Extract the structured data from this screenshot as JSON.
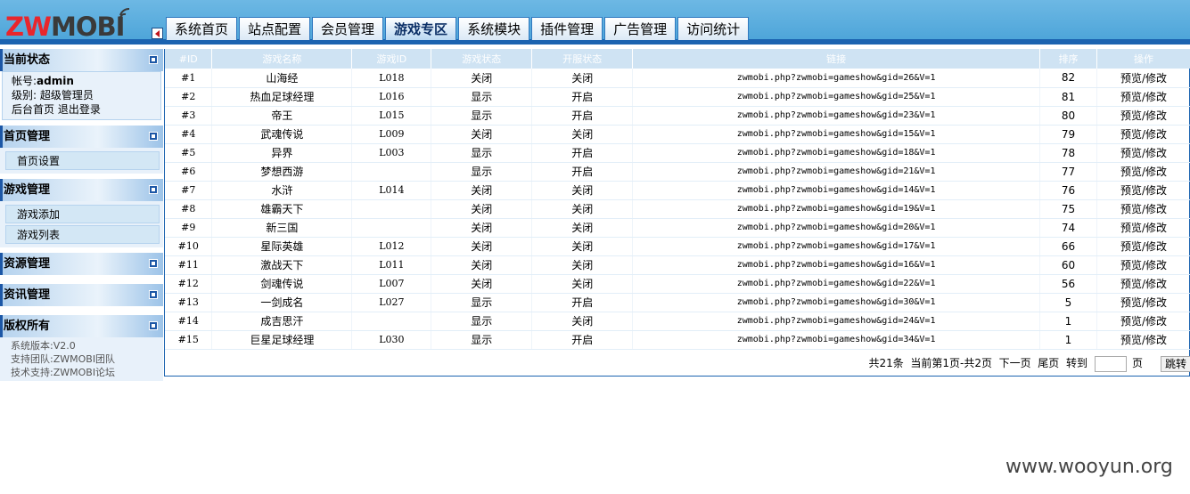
{
  "logo": {
    "red": "ZW",
    "gray": "MOBI"
  },
  "nav": {
    "tabs": [
      "系统首页",
      "站点配置",
      "会员管理",
      "游戏专区",
      "系统模块",
      "插件管理",
      "广告管理",
      "访问统计"
    ],
    "active_index": 3
  },
  "sidebar": {
    "status": {
      "title": "当前状态",
      "account_label": "帐号:",
      "account_value": "admin",
      "level_label": "级别:",
      "level_value": "超级管理员",
      "home_link": "后台首页",
      "logout_link": "退出登录"
    },
    "home_mgmt": {
      "title": "首页管理",
      "items": [
        "首页设置"
      ]
    },
    "game_mgmt": {
      "title": "游戏管理",
      "items": [
        "游戏添加",
        "游戏列表"
      ]
    },
    "resource_mgmt": {
      "title": "资源管理"
    },
    "news_mgmt": {
      "title": "资讯管理"
    },
    "copyright": {
      "title": "版权所有",
      "lines": [
        "系统版本:V2.0",
        "支持团队:ZWMOBI团队",
        "技术支持:ZWMOBI论坛"
      ]
    }
  },
  "table": {
    "headers": [
      "#ID",
      "游戏名称",
      "游戏ID",
      "游戏状态",
      "开服状态",
      "链接",
      "排序",
      "操作"
    ],
    "rows": [
      {
        "id": "#1",
        "name": "山海经",
        "gid": "L018",
        "status": "关闭",
        "server": "关闭",
        "link": "zwmobi.php?zwmobi=gameshow&gid=26&V=1",
        "sort": "82",
        "op": "预览/修改"
      },
      {
        "id": "#2",
        "name": "热血足球经理",
        "gid": "L016",
        "status": "显示",
        "server": "开启",
        "link": "zwmobi.php?zwmobi=gameshow&gid=25&V=1",
        "sort": "81",
        "op": "预览/修改"
      },
      {
        "id": "#3",
        "name": "帝王",
        "gid": "L015",
        "status": "显示",
        "server": "开启",
        "link": "zwmobi.php?zwmobi=gameshow&gid=23&V=1",
        "sort": "80",
        "op": "预览/修改"
      },
      {
        "id": "#4",
        "name": "武魂传说",
        "gid": "L009",
        "status": "关闭",
        "server": "关闭",
        "link": "zwmobi.php?zwmobi=gameshow&gid=15&V=1",
        "sort": "79",
        "op": "预览/修改"
      },
      {
        "id": "#5",
        "name": "异界",
        "gid": "L003",
        "status": "显示",
        "server": "开启",
        "link": "zwmobi.php?zwmobi=gameshow&gid=18&V=1",
        "sort": "78",
        "op": "预览/修改"
      },
      {
        "id": "#6",
        "name": "梦想西游",
        "gid": "",
        "status": "显示",
        "server": "开启",
        "link": "zwmobi.php?zwmobi=gameshow&gid=21&V=1",
        "sort": "77",
        "op": "预览/修改"
      },
      {
        "id": "#7",
        "name": "水浒",
        "gid": "L014",
        "status": "关闭",
        "server": "关闭",
        "link": "zwmobi.php?zwmobi=gameshow&gid=14&V=1",
        "sort": "76",
        "op": "预览/修改"
      },
      {
        "id": "#8",
        "name": "雄霸天下",
        "gid": "",
        "status": "关闭",
        "server": "关闭",
        "link": "zwmobi.php?zwmobi=gameshow&gid=19&V=1",
        "sort": "75",
        "op": "预览/修改"
      },
      {
        "id": "#9",
        "name": "新三国",
        "gid": "",
        "status": "关闭",
        "server": "关闭",
        "link": "zwmobi.php?zwmobi=gameshow&gid=20&V=1",
        "sort": "74",
        "op": "预览/修改"
      },
      {
        "id": "#10",
        "name": "星际英雄",
        "gid": "L012",
        "status": "关闭",
        "server": "关闭",
        "link": "zwmobi.php?zwmobi=gameshow&gid=17&V=1",
        "sort": "66",
        "op": "预览/修改"
      },
      {
        "id": "#11",
        "name": "激战天下",
        "gid": "L011",
        "status": "关闭",
        "server": "关闭",
        "link": "zwmobi.php?zwmobi=gameshow&gid=16&V=1",
        "sort": "60",
        "op": "预览/修改"
      },
      {
        "id": "#12",
        "name": "剑魂传说",
        "gid": "L007",
        "status": "关闭",
        "server": "关闭",
        "link": "zwmobi.php?zwmobi=gameshow&gid=22&V=1",
        "sort": "56",
        "op": "预览/修改"
      },
      {
        "id": "#13",
        "name": "一剑成名",
        "gid": "L027",
        "status": "显示",
        "server": "开启",
        "link": "zwmobi.php?zwmobi=gameshow&gid=30&V=1",
        "sort": "5",
        "op": "预览/修改"
      },
      {
        "id": "#14",
        "name": "成吉思汗",
        "gid": "",
        "status": "显示",
        "server": "关闭",
        "link": "zwmobi.php?zwmobi=gameshow&gid=24&V=1",
        "sort": "1",
        "op": "预览/修改"
      },
      {
        "id": "#15",
        "name": "巨星足球经理",
        "gid": "L030",
        "status": "显示",
        "server": "开启",
        "link": "zwmobi.php?zwmobi=gameshow&gid=34&V=1",
        "sort": "1",
        "op": "预览/修改"
      }
    ]
  },
  "pager": {
    "total": "共21条",
    "current": "当前第1页-共2页",
    "next": "下一页",
    "last": "尾页",
    "goto_label": "转到",
    "page_unit": "页",
    "go_button": "跳转"
  },
  "watermark": "www.wooyun.org"
}
